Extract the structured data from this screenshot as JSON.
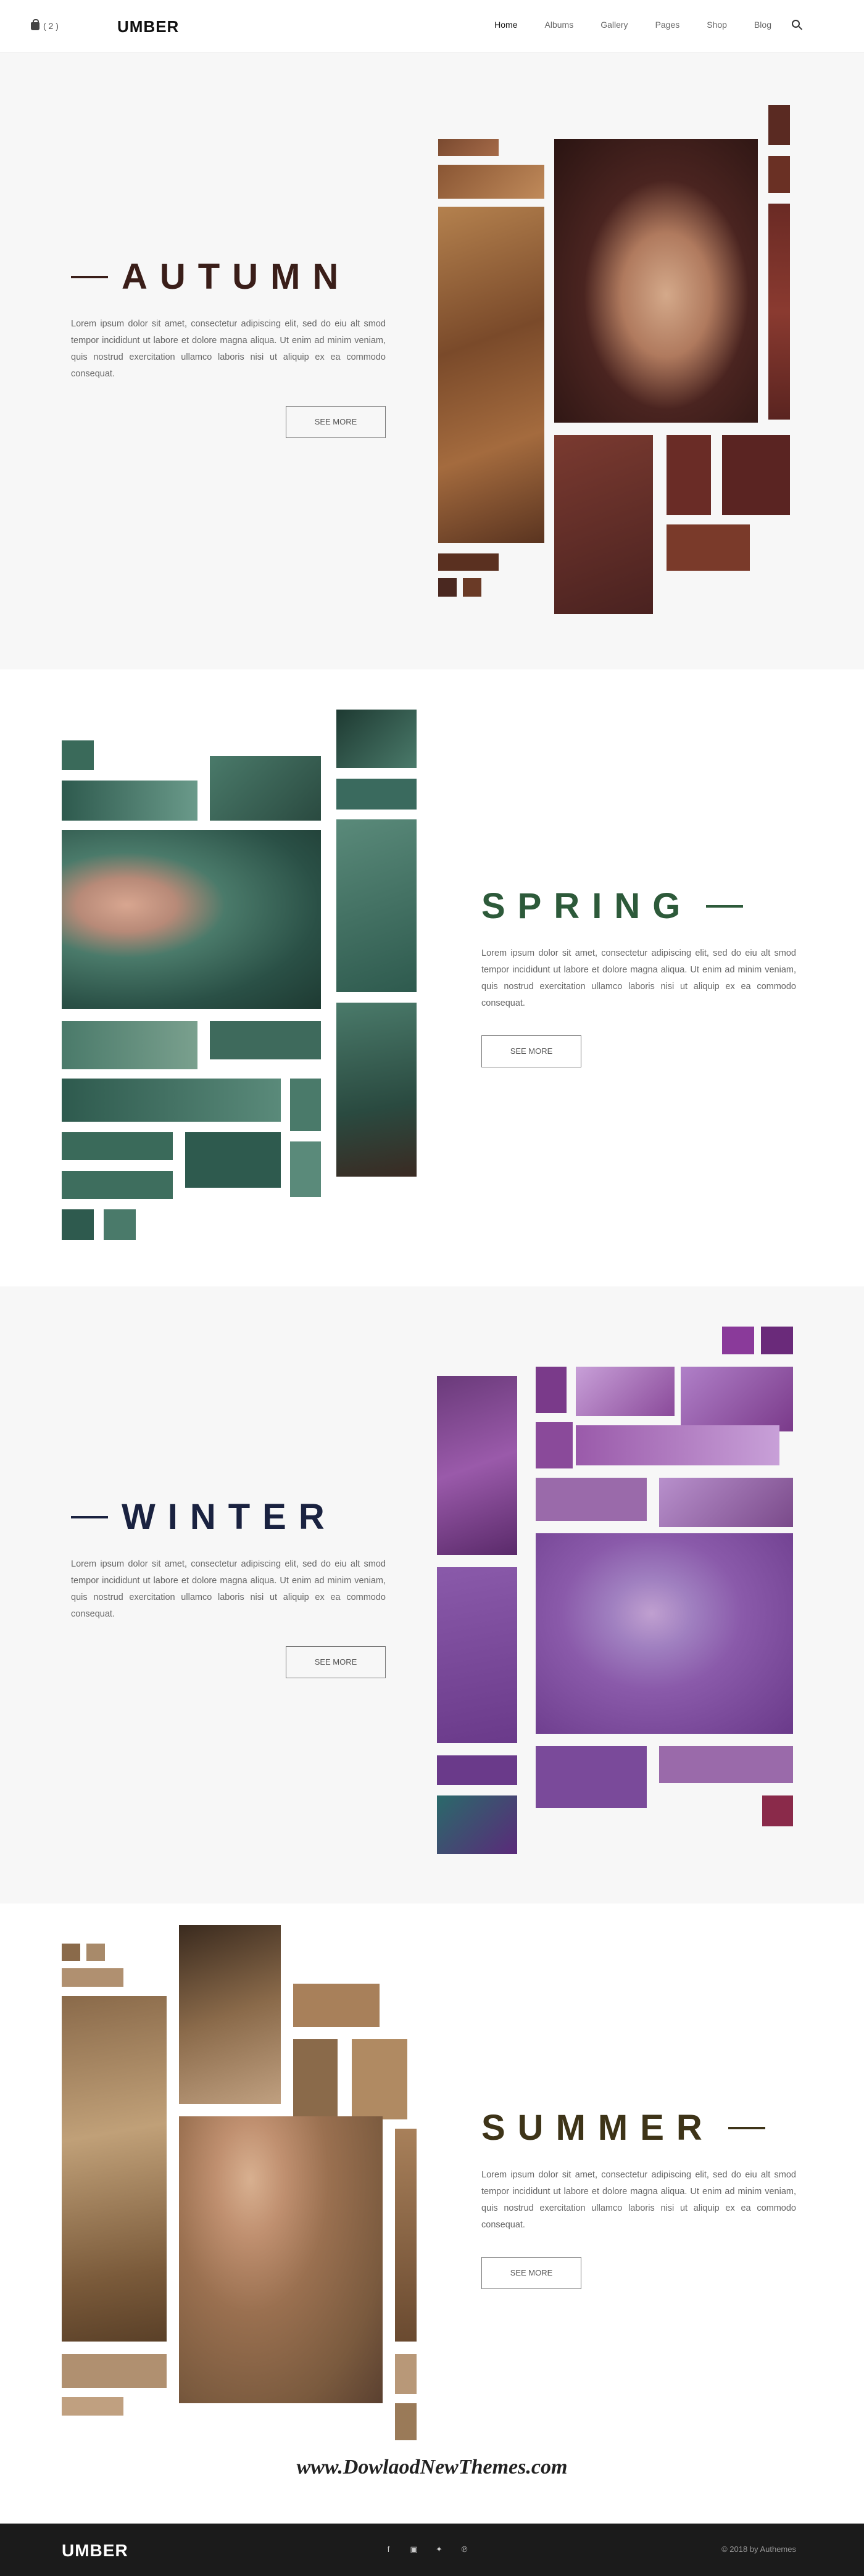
{
  "header": {
    "cart_count": "( 2 )",
    "logo": "UMBER",
    "nav": [
      "Home",
      "Albums",
      "Gallery",
      "Pages",
      "Shop",
      "Blog"
    ],
    "active_nav": "Home"
  },
  "sections": [
    {
      "title": "AUTUMN",
      "text": "Lorem ipsum dolor sit amet, consectetur adipiscing elit, sed do eiu alt smod tempor incididunt ut labore et dolore magna aliqua. Ut enim ad minim veniam, quis nostrud exercitation ullamco laboris nisi ut aliquip ex ea commodo consequat.",
      "button": "SEE MORE",
      "accent": "#3a1e19"
    },
    {
      "title": "SPRING",
      "text": "Lorem ipsum dolor sit amet, consectetur adipiscing elit, sed do eiu alt smod tempor incididunt ut labore et dolore magna aliqua. Ut enim ad minim veniam, quis nostrud exercitation ullamco laboris nisi ut aliquip ex ea commodo consequat.",
      "button": "SEE MORE",
      "accent": "#2d5a3a"
    },
    {
      "title": "WINTER",
      "text": "Lorem ipsum dolor sit amet, consectetur adipiscing elit, sed do eiu alt smod tempor incididunt ut labore et dolore magna aliqua. Ut enim ad minim veniam, quis nostrud exercitation ullamco laboris nisi ut aliquip ex ea commodo consequat.",
      "button": "SEE MORE",
      "accent": "#1a2240"
    },
    {
      "title": "SUMMER",
      "text": "Lorem ipsum dolor sit amet, consectetur adipiscing elit, sed do eiu alt smod tempor incididunt ut labore et dolore magna aliqua. Ut enim ad minim veniam, quis nostrud exercitation ullamco laboris nisi ut aliquip ex ea commodo consequat.",
      "button": "SEE MORE",
      "accent": "#3e3418"
    }
  ],
  "watermark": "www.DowlaodNewThemes.com",
  "footer": {
    "logo": "UMBER",
    "social": [
      "facebook-icon",
      "instagram-icon",
      "twitter-icon",
      "pinterest-icon"
    ],
    "copyright": "© 2018 by Authemes"
  }
}
